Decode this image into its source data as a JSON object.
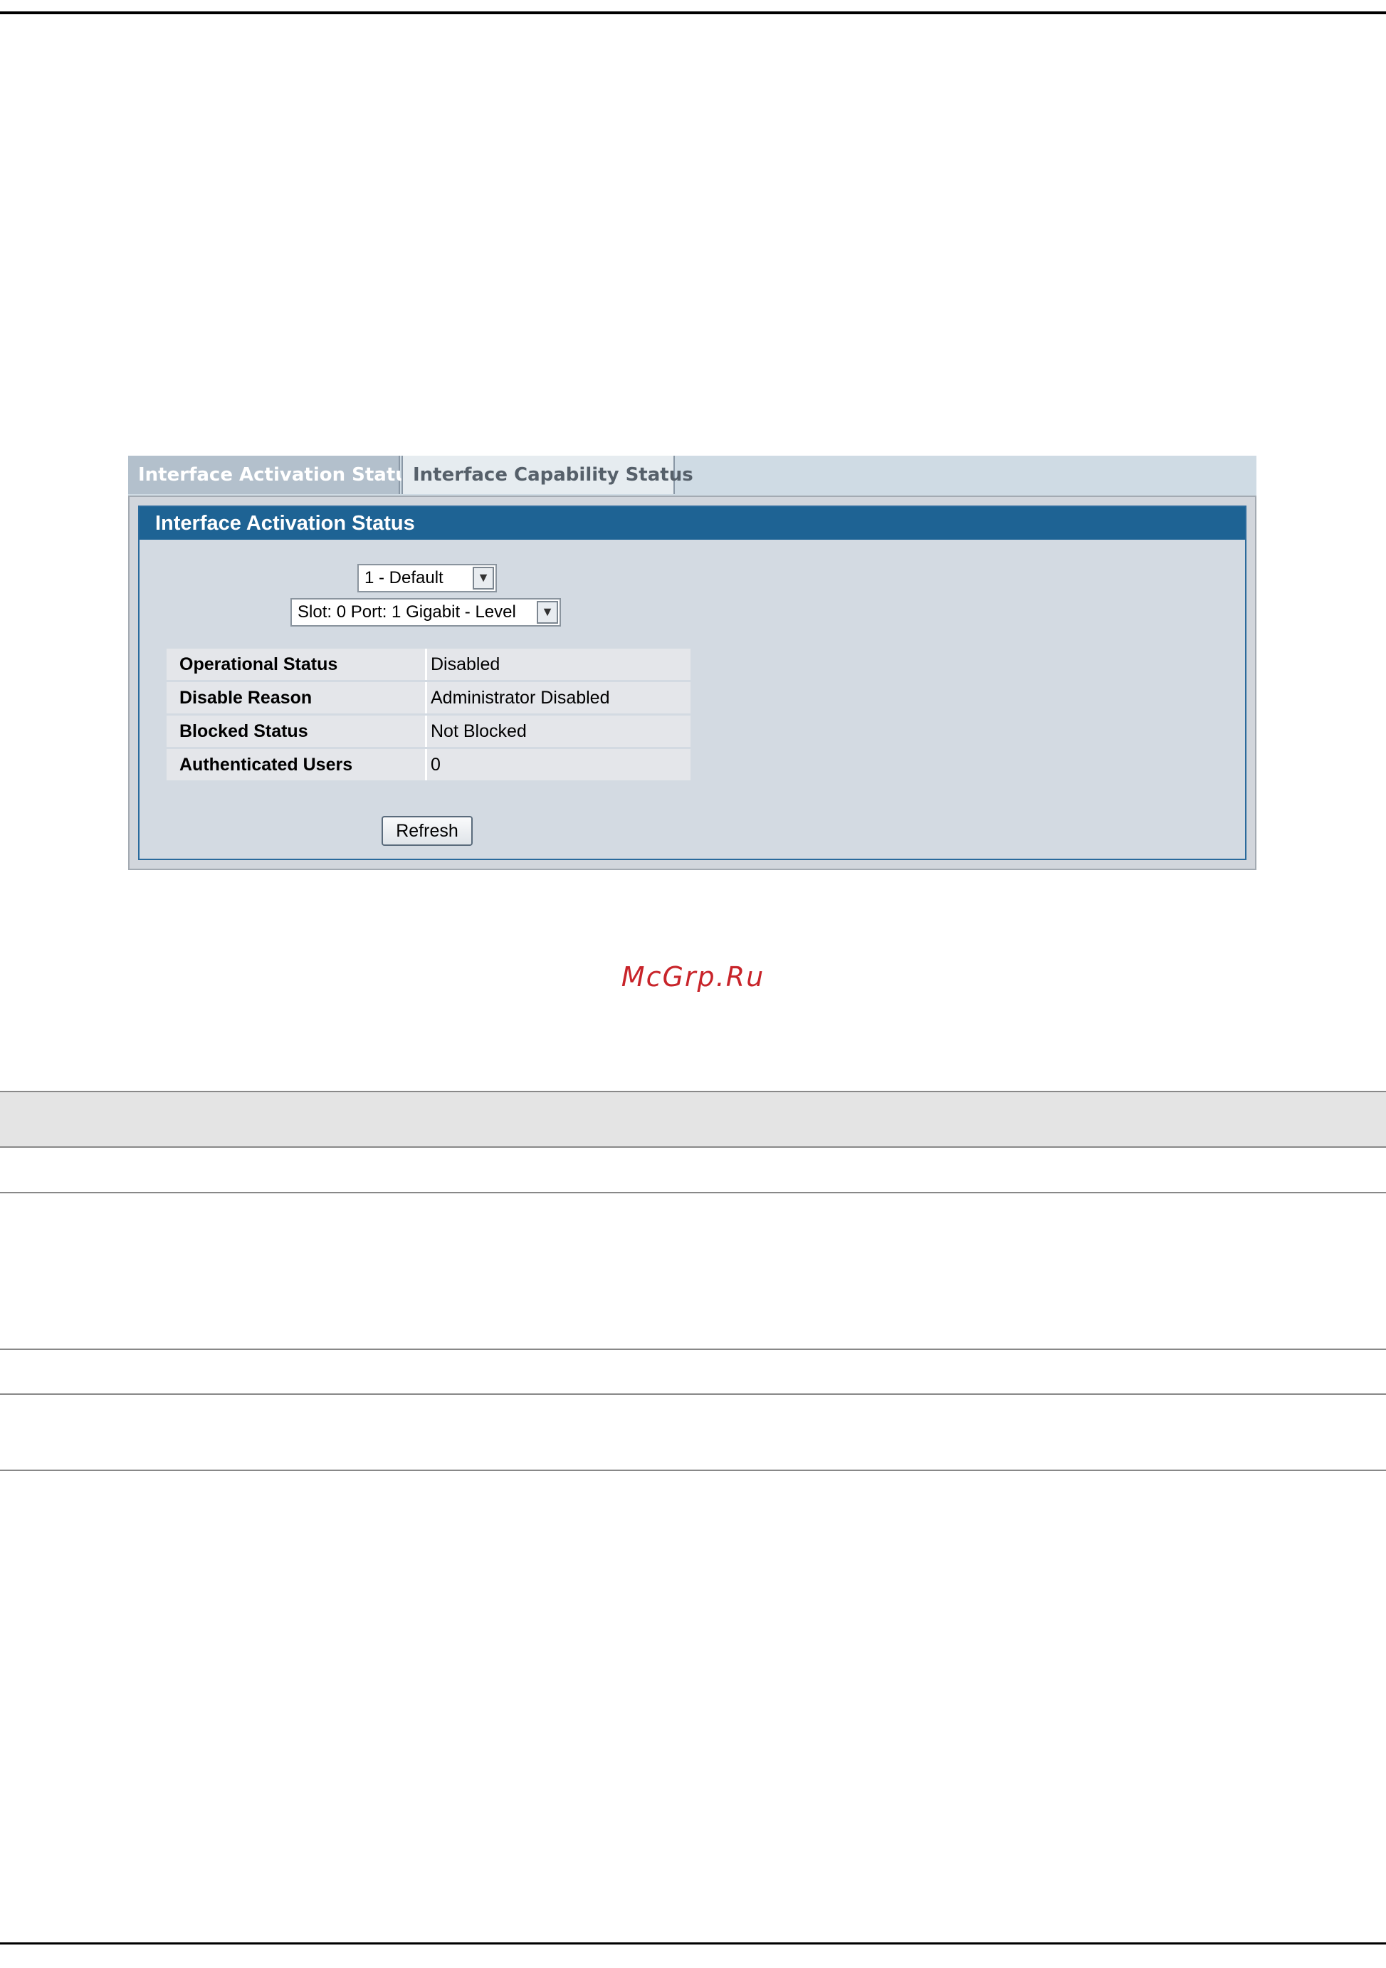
{
  "tabs": {
    "active_label": "Interface Activation Status",
    "inactive_label": "Interface Capability Status"
  },
  "panel": {
    "title": "Interface Activation Status"
  },
  "selects": {
    "vlan_value": "1 - Default",
    "port_value": "Slot: 0 Port: 1 Gigabit - Level"
  },
  "status_rows": [
    {
      "label": "Operational Status",
      "value": "Disabled"
    },
    {
      "label": "Disable Reason",
      "value": "Administrator Disabled"
    },
    {
      "label": "Blocked Status",
      "value": "Not Blocked"
    },
    {
      "label": "Authenticated Users",
      "value": "0"
    }
  ],
  "buttons": {
    "refresh_label": "Refresh"
  },
  "watermark": "McGrp.Ru"
}
